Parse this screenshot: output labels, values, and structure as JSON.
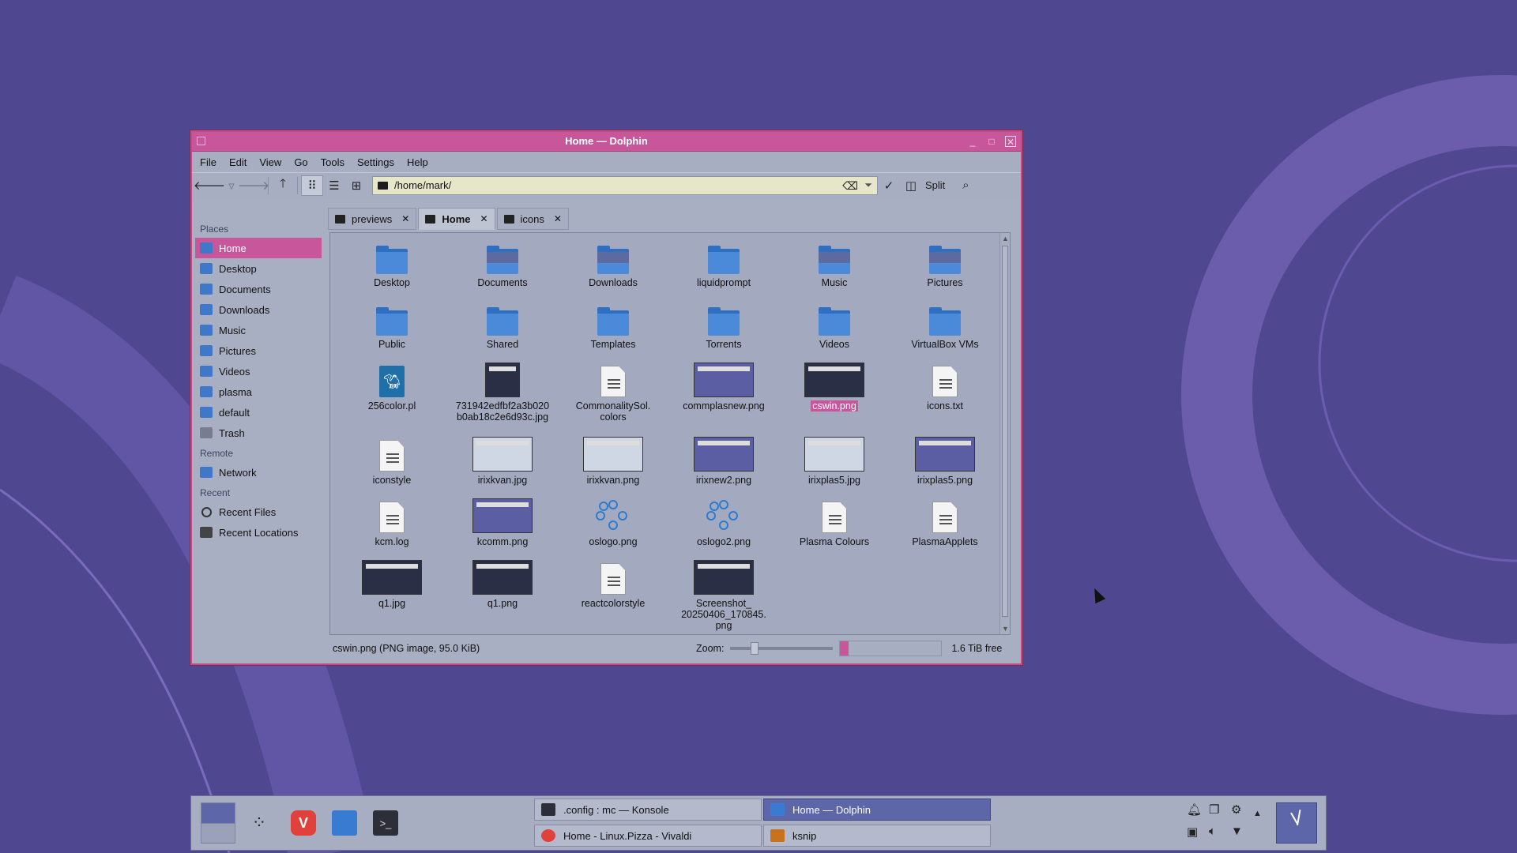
{
  "window": {
    "title": "Home — Dolphin",
    "menus": [
      "File",
      "Edit",
      "View",
      "Go",
      "Tools",
      "Settings",
      "Help"
    ],
    "location_path": "/home/mark/",
    "split_label": "Split"
  },
  "sidebar": {
    "places_header": "Places",
    "places": [
      "Home",
      "Desktop",
      "Documents",
      "Downloads",
      "Music",
      "Pictures",
      "Videos",
      "plasma",
      "default",
      "Trash"
    ],
    "remote_header": "Remote",
    "remote": [
      "Network"
    ],
    "recent_header": "Recent",
    "recent": [
      "Recent Files",
      "Recent Locations"
    ]
  },
  "tabs": [
    "previews",
    "Home",
    "icons"
  ],
  "files": [
    {
      "name": "Desktop",
      "kind": "folder"
    },
    {
      "name": "Documents",
      "kind": "folder-preview"
    },
    {
      "name": "Downloads",
      "kind": "folder-preview"
    },
    {
      "name": "liquidprompt",
      "kind": "folder"
    },
    {
      "name": "Music",
      "kind": "folder-preview"
    },
    {
      "name": "Pictures",
      "kind": "folder-preview"
    },
    {
      "name": "Public",
      "kind": "folder"
    },
    {
      "name": "Shared",
      "kind": "folder"
    },
    {
      "name": "Templates",
      "kind": "folder"
    },
    {
      "name": "Torrents",
      "kind": "folder"
    },
    {
      "name": "Videos",
      "kind": "folder"
    },
    {
      "name": "VirtualBox VMs",
      "kind": "folder"
    },
    {
      "name": "256color.pl",
      "kind": "perl"
    },
    {
      "name": "731942edfbf2a3b020\nb0ab18c2e6d93c.jpg",
      "kind": "image-dark"
    },
    {
      "name": "CommonalitySol.\ncolors",
      "kind": "doc"
    },
    {
      "name": "commplasnew.png",
      "kind": "image"
    },
    {
      "name": "cswin.png",
      "kind": "image-dark",
      "selected": true
    },
    {
      "name": "icons.txt",
      "kind": "doc"
    },
    {
      "name": "iconstyle",
      "kind": "doc"
    },
    {
      "name": "irixkvan.jpg",
      "kind": "image-light"
    },
    {
      "name": "irixkvan.png",
      "kind": "image-light"
    },
    {
      "name": "irixnew2.png",
      "kind": "image"
    },
    {
      "name": "irixplas5.jpg",
      "kind": "image-light"
    },
    {
      "name": "irixplas5.png",
      "kind": "image"
    },
    {
      "name": "kcm.log",
      "kind": "doc"
    },
    {
      "name": "kcomm.png",
      "kind": "image"
    },
    {
      "name": "oslogo.png",
      "kind": "dots"
    },
    {
      "name": "oslogo2.png",
      "kind": "dots"
    },
    {
      "name": "Plasma Colours",
      "kind": "doc"
    },
    {
      "name": "PlasmaApplets",
      "kind": "doc"
    },
    {
      "name": "q1.jpg",
      "kind": "image-dark"
    },
    {
      "name": "q1.png",
      "kind": "image-dark"
    },
    {
      "name": "reactcolorstyle",
      "kind": "doc"
    },
    {
      "name": "Screenshot_\n20250406_170845.\npng",
      "kind": "image-dark"
    }
  ],
  "status": {
    "selection": "cswin.png (PNG image, 95.0 KiB)",
    "zoom_label": "Zoom:",
    "free_space": "1.6 TiB free",
    "used_fraction": 0.08
  },
  "taskbar": {
    "tasks": [
      {
        "label": ".config : mc — Konsole",
        "active": false
      },
      {
        "label": "Home — Dolphin",
        "active": true
      },
      {
        "label": "Home - Linux.Pizza - Vivaldi",
        "active": false
      },
      {
        "label": "ksnip",
        "active": false
      }
    ]
  },
  "colors": {
    "accent": "#c7579a",
    "desktop": "#4f4891",
    "folder": "#4a8ad8"
  }
}
